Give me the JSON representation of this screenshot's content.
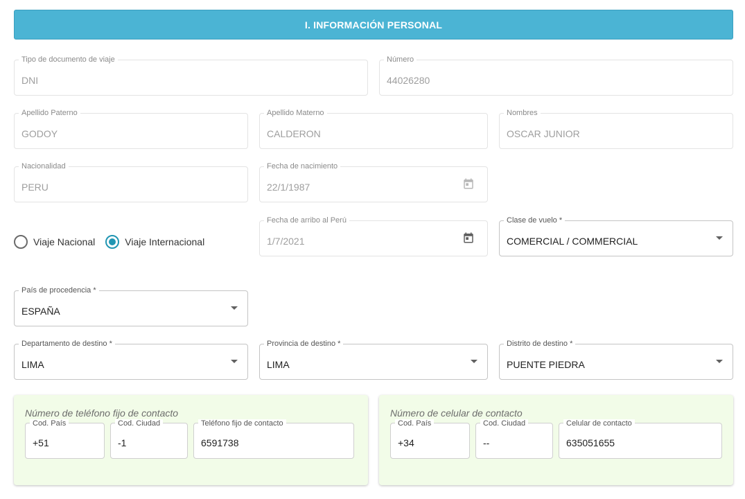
{
  "section": {
    "title": "I. INFORMACIÓN PERSONAL"
  },
  "fields": {
    "tipo_documento": {
      "label": "Tipo de documento de viaje",
      "value": "DNI"
    },
    "numero": {
      "label": "Número",
      "value": "44026280"
    },
    "apellido_paterno": {
      "label": "Apellido Paterno",
      "value": "GODOY"
    },
    "apellido_materno": {
      "label": "Apellido Materno",
      "value": "CALDERON"
    },
    "nombres": {
      "label": "Nombres",
      "value": "OSCAR JUNIOR"
    },
    "nacionalidad": {
      "label": "Nacionalidad",
      "value": "PERU"
    },
    "fecha_nacimiento": {
      "label": "Fecha de nacimiento",
      "value": "22/1/1987"
    },
    "fecha_arribo": {
      "label": "Fecha de arribo al Perú",
      "value": "1/7/2021"
    },
    "clase_vuelo": {
      "label": "Clase de vuelo *",
      "value": "COMERCIAL / COMMERCIAL"
    },
    "pais_procedencia": {
      "label": "País de procedencia *",
      "value": "ESPAÑA"
    },
    "departamento": {
      "label": "Departamento de destino *",
      "value": "LIMA"
    },
    "provincia": {
      "label": "Provincia de destino *",
      "value": "LIMA"
    },
    "distrito": {
      "label": "Distrito de destino *",
      "value": "PUENTE PIEDRA"
    }
  },
  "travel_type": {
    "options": [
      {
        "label": "Viaje Nacional",
        "checked": false
      },
      {
        "label": "Viaje Internacional",
        "checked": true
      }
    ]
  },
  "phone_fixed": {
    "title": "Número de teléfono fijo de contacto",
    "cod_pais": {
      "label": "Cod. País",
      "value": "+51"
    },
    "cod_ciudad": {
      "label": "Cod. Ciudad",
      "value": "-1"
    },
    "telefono": {
      "label": "Teléfono fijo de contacto",
      "value": "6591738"
    }
  },
  "phone_mobile": {
    "title": "Número de celular de contacto",
    "cod_pais": {
      "label": "Cod. País",
      "value": "+34"
    },
    "cod_ciudad": {
      "label": "Cod. Ciudad",
      "value": "--"
    },
    "celular": {
      "label": "Celular de contacto",
      "value": "635051655"
    }
  },
  "colors": {
    "header": "#4bb4d4",
    "radio_accent": "#2196b3",
    "panel_bg": "#f2fce8"
  },
  "icons": {
    "calendar": "calendar-icon",
    "dropdown": "chevron-down-icon"
  }
}
